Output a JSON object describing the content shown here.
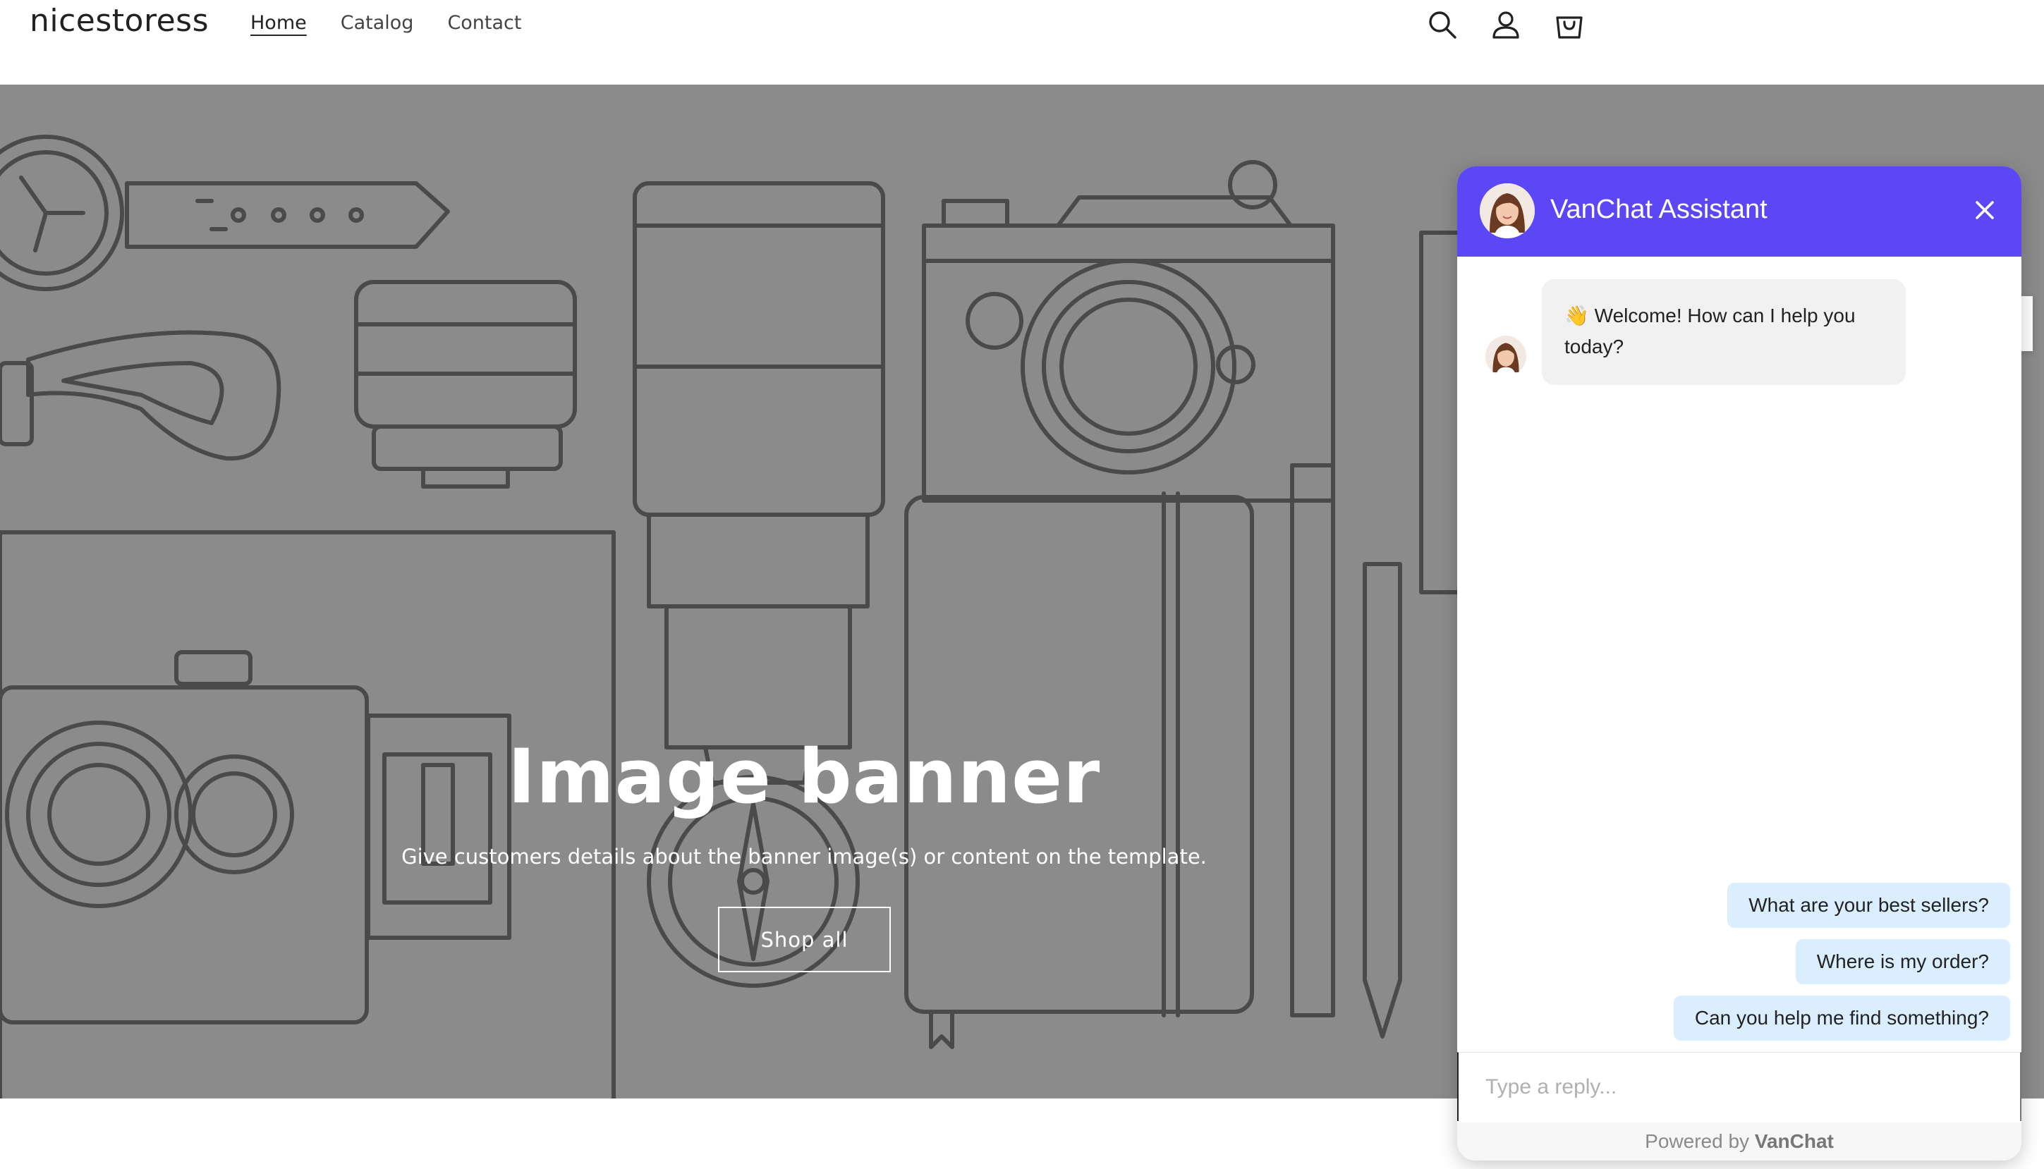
{
  "store": {
    "name": "nicestoress"
  },
  "nav": {
    "items": [
      {
        "label": "Home",
        "active": true
      },
      {
        "label": "Catalog",
        "active": false
      },
      {
        "label": "Contact",
        "active": false
      }
    ]
  },
  "header_icons": [
    "search-icon",
    "account-icon",
    "cart-icon"
  ],
  "banner": {
    "title": "Image banner",
    "subtitle": "Give customers details about the banner image(s) or content on the template.",
    "button_label": "Shop all",
    "background_color": "#8b8b8b",
    "line_color": "#4a4a4a"
  },
  "chat": {
    "title": "VanChat Assistant",
    "header_color": "#5b47f5",
    "welcome_emoji": "👋",
    "welcome_text": "Welcome! How can I help you today?",
    "quick_replies": [
      "What are your best sellers?",
      "Where is my order?",
      "Can you help me find something?"
    ],
    "input_placeholder": "Type a reply...",
    "powered_prefix": "Powered by",
    "powered_brand": "VanChat"
  }
}
